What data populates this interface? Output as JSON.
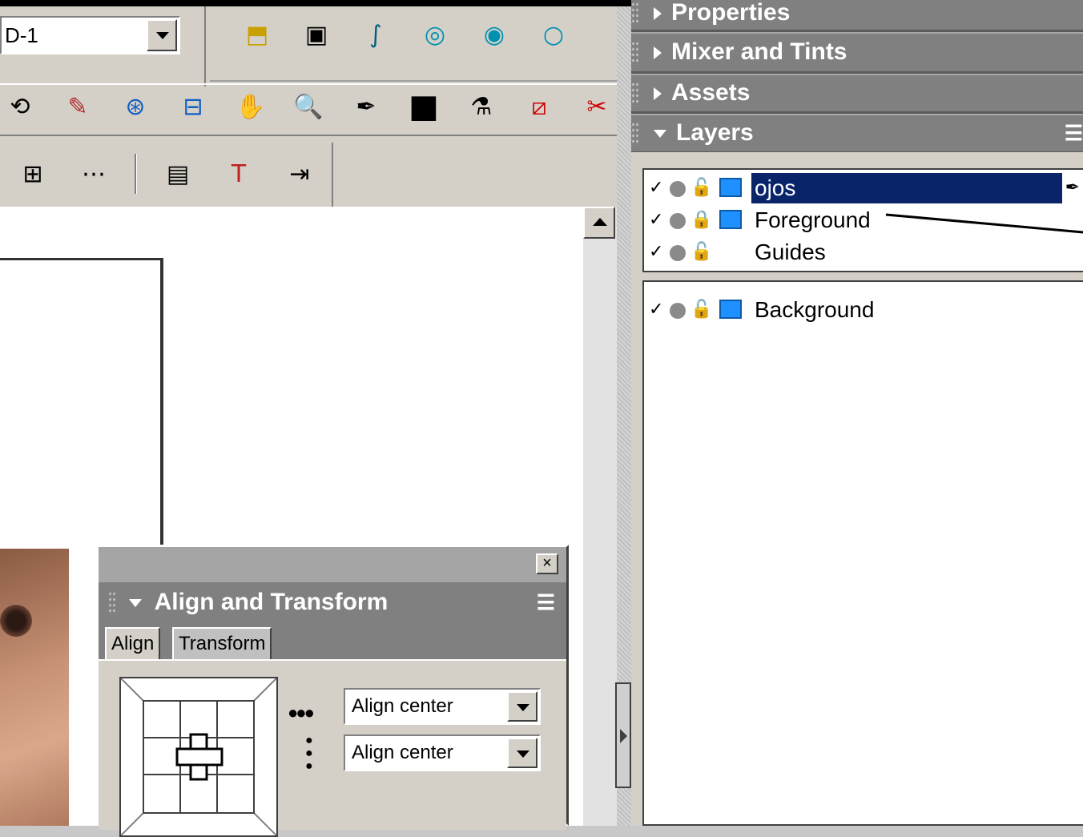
{
  "toolbar": {
    "document_combo": "D-1",
    "row1_icons": [
      "distort-icon",
      "inset-path-icon",
      "freeform-icon",
      "union-icon",
      "intersect-icon",
      "punch-icon",
      "crop-icon"
    ],
    "row2_icons": [
      "rotate-icon",
      "bezigon-icon",
      "spiral-icon",
      "link-icon",
      "hand-icon",
      "zoom-icon",
      "eyedropper-icon",
      "fill-color-icon",
      "paint-bucket-icon",
      "stroke-color-icon",
      "trace-icon"
    ],
    "row3_icons": [
      "grid-icon",
      "blend-icon",
      "text-box-icon",
      "spell-check-icon",
      "indent-icon"
    ]
  },
  "right_panels": {
    "properties": "Properties",
    "mixer": "Mixer and Tints",
    "assets": "Assets",
    "layers": "Layers"
  },
  "layers": [
    {
      "name": "ojos",
      "visible": "✓",
      "lock": "🔓",
      "selected": true
    },
    {
      "name": "Foreground",
      "visible": "✓",
      "lock": "🔒",
      "selected": false
    },
    {
      "name": "Guides",
      "visible": "✓",
      "lock": "🔓",
      "selected": false
    }
  ],
  "background_layer": {
    "name": "Background",
    "visible": "✓",
    "lock": "🔓"
  },
  "align_panel": {
    "title": "Align and Transform",
    "tabs": [
      "Align",
      "Transform"
    ],
    "horizontal_select": "Align center",
    "vertical_select": "Align center",
    "close": "×"
  },
  "colors": {
    "layer_swatch": "#1e90ff",
    "selection": "#0a246a",
    "panel_bar": "#808080"
  }
}
